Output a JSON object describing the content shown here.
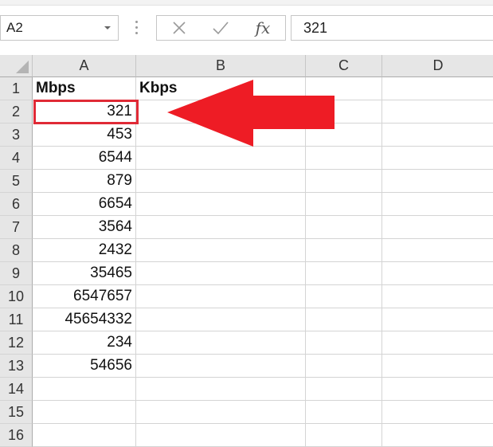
{
  "formula_bar": {
    "name_box": "A2",
    "cancel_icon": "close-icon",
    "enter_icon": "check-icon",
    "function_label": "fx",
    "formula_value": "321"
  },
  "columns": [
    "A",
    "B",
    "C",
    "D"
  ],
  "rows": [
    "1",
    "2",
    "3",
    "4",
    "5",
    "6",
    "7",
    "8",
    "9",
    "10",
    "11",
    "12",
    "13",
    "14",
    "15",
    "16"
  ],
  "cells": {
    "A1": "Mbps",
    "B1": "Kbps",
    "A2": "321",
    "A3": "453",
    "A4": "6544",
    "A5": "879",
    "A6": "6654",
    "A7": "3564",
    "A8": "2432",
    "A9": "35465",
    "A10": "6547657",
    "A11": "45654332",
    "A12": "234",
    "A13": "54656"
  },
  "selected_cell": "A2",
  "annotation": {
    "arrow_color": "#ee1c25",
    "highlight_color": "#e02a36"
  }
}
